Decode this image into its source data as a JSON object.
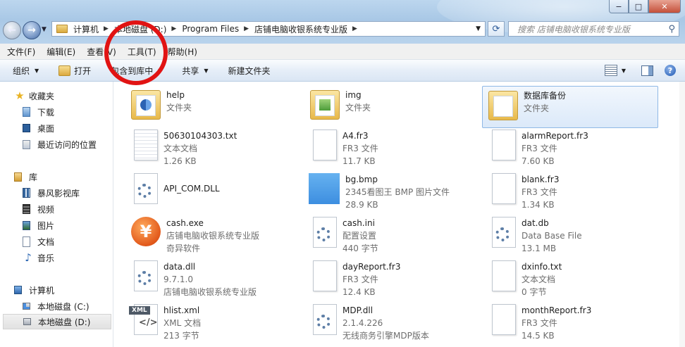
{
  "window": {
    "buttons": [
      "−",
      "□",
      "✕"
    ]
  },
  "address": {
    "crumbs": [
      "计算机",
      "本地磁盘 (D:)",
      "Program Files",
      "店铺电脑收银系统专业版"
    ]
  },
  "search": {
    "placeholder": "搜索 店铺电脑收银系统专业版"
  },
  "menu": [
    "文件(F)",
    "编辑(E)",
    "查看(V)",
    "工具(T)",
    "帮助(H)"
  ],
  "toolbar": {
    "organize": "组织",
    "open": "打开",
    "include": "包含到库中",
    "share": "共享",
    "newfolder": "新建文件夹"
  },
  "nav": {
    "favorites": "收藏夹",
    "downloads": "下载",
    "desktop": "桌面",
    "recent": "最近访问的位置",
    "libraries": "库",
    "storm": "暴风影视库",
    "video": "视频",
    "pictures": "图片",
    "docs": "文档",
    "music": "音乐",
    "computer": "计算机",
    "drive_c": "本地磁盘 (C:)",
    "drive_d": "本地磁盘 (D:)"
  },
  "files": [
    {
      "name": "help",
      "l2": "文件夹",
      "l3": ""
    },
    {
      "name": "img",
      "l2": "文件夹",
      "l3": ""
    },
    {
      "name": "数据库备份",
      "l2": "文件夹",
      "l3": ""
    },
    {
      "name": "50630104303.txt",
      "l2": "文本文档",
      "l3": "1.26 KB"
    },
    {
      "name": "A4.fr3",
      "l2": "FR3 文件",
      "l3": "11.7 KB"
    },
    {
      "name": "alarmReport.fr3",
      "l2": "FR3 文件",
      "l3": "7.60 KB"
    },
    {
      "name": "API_COM.DLL",
      "l2": "",
      "l3": ""
    },
    {
      "name": "bg.bmp",
      "l2": "2345看图王 BMP 图片文件",
      "l3": "28.9 KB"
    },
    {
      "name": "blank.fr3",
      "l2": "FR3 文件",
      "l3": "1.34 KB"
    },
    {
      "name": "cash.exe",
      "l2": "店铺电脑收银系统专业版",
      "l3": "奇异软件"
    },
    {
      "name": "cash.ini",
      "l2": "配置设置",
      "l3": "440 字节"
    },
    {
      "name": "dat.db",
      "l2": "Data Base File",
      "l3": "13.1 MB"
    },
    {
      "name": "data.dll",
      "l2": "9.7.1.0",
      "l3": "店铺电脑收银系统专业版"
    },
    {
      "name": "dayReport.fr3",
      "l2": "FR3 文件",
      "l3": "12.4 KB"
    },
    {
      "name": "dxinfo.txt",
      "l2": "文本文档",
      "l3": "0 字节"
    },
    {
      "name": "hlist.xml",
      "l2": "XML 文档",
      "l3": "213 字节"
    },
    {
      "name": "MDP.dll",
      "l2": "2.1.4.226",
      "l3": "无线商务引擎MDP版本"
    },
    {
      "name": "monthReport.fr3",
      "l2": "FR3 文件",
      "l3": "14.5 KB"
    }
  ],
  "icons": {
    "xml_tag": "XML",
    "xml_code": "</>",
    "yen": "¥"
  }
}
